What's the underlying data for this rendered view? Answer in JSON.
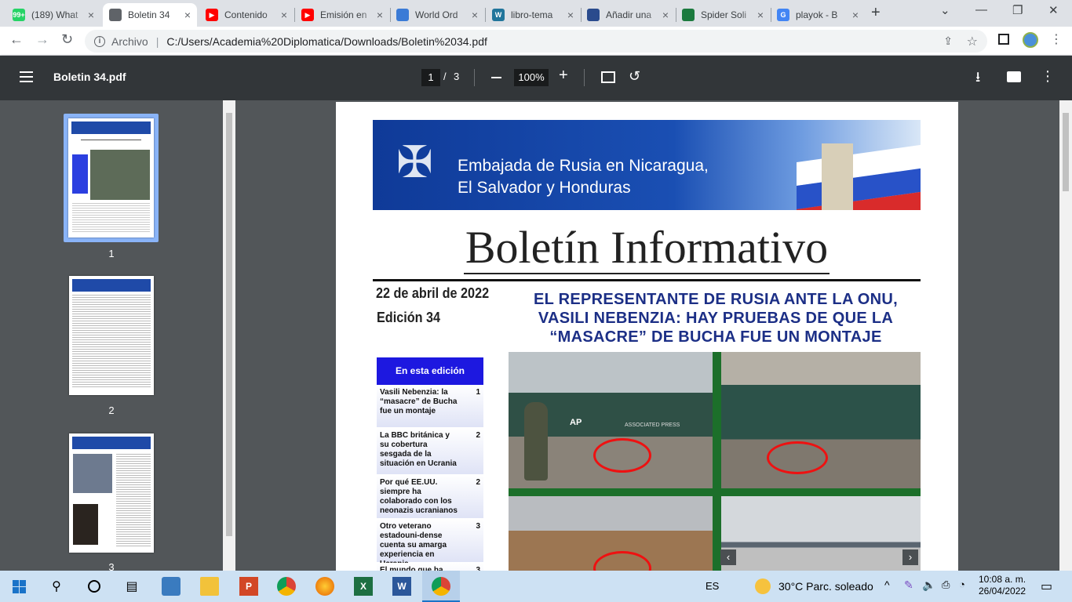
{
  "tabs": [
    {
      "title": "(189) What",
      "fav": "99+",
      "color": "#25d366"
    },
    {
      "title": "Boletin 34",
      "fav": "",
      "color": "#5f6368",
      "active": true
    },
    {
      "title": "Contenido",
      "fav": "▶",
      "color": "#ff0000"
    },
    {
      "title": "Emisión en",
      "fav": "▶",
      "color": "#ff0000"
    },
    {
      "title": "World Ord",
      "fav": "",
      "color": "#3b7bd6"
    },
    {
      "title": "libro-tema",
      "fav": "W",
      "color": "#21759b"
    },
    {
      "title": "Añadir una",
      "fav": "",
      "color": "#2a4b8d"
    },
    {
      "title": "Spider Soli",
      "fav": "",
      "color": "#1b7a3e"
    },
    {
      "title": "playok - B",
      "fav": "G",
      "color": "#4285f4"
    }
  ],
  "address": {
    "source": "Archivo",
    "url": "C:/Users/Academia%20Diplomatica/Downloads/Boletin%2034.pdf"
  },
  "pdf": {
    "filename": "Boletin 34.pdf",
    "page_current": "1",
    "page_sep": "/",
    "page_total": "3",
    "zoom": "100%"
  },
  "thumbnails": [
    {
      "label": "1"
    },
    {
      "label": "2"
    },
    {
      "label": "3"
    }
  ],
  "document": {
    "banner_line1": "Embajada de Rusia en Nicaragua,",
    "banner_line2": "El Salvador y Honduras",
    "title": "Boletín Informativo",
    "date": "22 de abril de 2022",
    "edition": "Edición 34",
    "headline": "EL REPRESENTANTE DE RUSIA ANTE LA ONU, VASILI NEBENZIA: HAY PRUEBAS DE QUE LA “MASACRE” DE BUCHA FUE UN MONTAJE",
    "toc_title": "En esta edición",
    "toc": [
      {
        "text": "Vasili Nebenzia: la “masacre” de Bucha fue un montaje",
        "page": "1"
      },
      {
        "text": "La BBC británica y su cobertura sesgada de la situación en Ucrania",
        "page": "2"
      },
      {
        "text": "Por qué EE.UU. siempre ha colaborado con los neonazis ucranianos",
        "page": "2"
      },
      {
        "text": "Otro veterano estadouni-dense cuenta su amarga experiencia en Ucrania",
        "page": "3"
      },
      {
        "text": "El mundo que ha",
        "page": "3"
      }
    ],
    "photo_watermark": "ASSOCIATED PRESS",
    "photo_tag": "AP"
  },
  "taskbar": {
    "lang": "ES",
    "weather": "30°C  Parc. soleado",
    "time": "10:08 a. m.",
    "date": "26/04/2022"
  }
}
